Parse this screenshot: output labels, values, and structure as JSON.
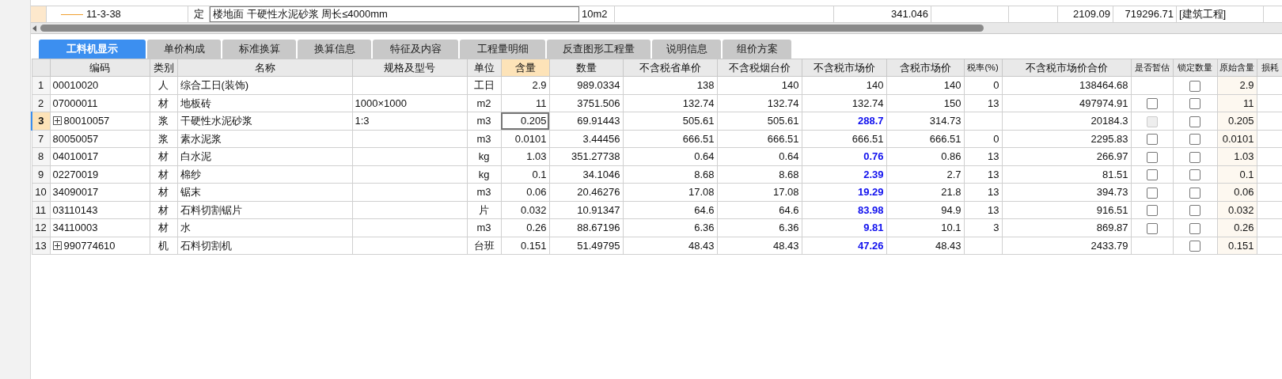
{
  "top_row": {
    "code": "11-3-38",
    "category": "定",
    "name": "楼地面 干硬性水泥砂浆 周长≤4000mm",
    "unit": "10m2",
    "column_6": "341.046",
    "column_9": "2109.09",
    "column_10": "719296.71",
    "column_11": "[建筑工程]"
  },
  "tabs": [
    {
      "label": "工料机显示",
      "selected": true
    },
    {
      "label": "单价构成",
      "selected": false
    },
    {
      "label": "标准换算",
      "selected": false
    },
    {
      "label": "换算信息",
      "selected": false
    },
    {
      "label": "特征及内容",
      "selected": false
    },
    {
      "label": "工程量明细",
      "selected": false
    },
    {
      "label": "反查图形工程量",
      "selected": false
    },
    {
      "label": "说明信息",
      "selected": false
    },
    {
      "label": "组价方案",
      "selected": false
    }
  ],
  "columns": [
    {
      "label": "编码",
      "selected": false
    },
    {
      "label": "类别",
      "selected": false
    },
    {
      "label": "名称",
      "selected": false
    },
    {
      "label": "规格及型号",
      "selected": false
    },
    {
      "label": "单位",
      "selected": false
    },
    {
      "label": "含量",
      "selected": true
    },
    {
      "label": "数量",
      "selected": false
    },
    {
      "label": "不含税省单价",
      "selected": false
    },
    {
      "label": "不含税烟台价",
      "selected": false
    },
    {
      "label": "不含税市场价",
      "selected": false
    },
    {
      "label": "含税市场价",
      "selected": false
    },
    {
      "label": "税率(%)",
      "selected": false
    },
    {
      "label": "不含税市场价合价",
      "selected": false
    },
    {
      "label": "是否暂估",
      "selected": false
    },
    {
      "label": "锁定数量",
      "selected": false
    },
    {
      "label": "原始含量",
      "selected": false
    },
    {
      "label": "损耗",
      "selected": false
    }
  ],
  "rows": [
    {
      "num": "1",
      "code": "00010020",
      "expandable": false,
      "category": "人",
      "name": "综合工日(装饰)",
      "spec": "",
      "unit": "工日",
      "content": "2.9",
      "quantity": "989.0334",
      "price_province": "138",
      "price_yantai": "140",
      "price_market": "140",
      "market_adjusted": false,
      "price_tax": "140",
      "tax_rate": "0",
      "total": "138464.68",
      "locked": false,
      "original_content": "2.9",
      "selected": false
    },
    {
      "num": "2",
      "code": "07000011",
      "expandable": false,
      "category": "材",
      "name": "地板砖",
      "spec": "1000×1000",
      "unit": "m2",
      "content": "11",
      "quantity": "3751.506",
      "price_province": "132.74",
      "price_yantai": "132.74",
      "price_market": "132.74",
      "market_adjusted": false,
      "price_tax": "150",
      "tax_rate": "13",
      "total": "497974.91",
      "provisional": {
        "checked": false,
        "disabled": false
      },
      "locked": false,
      "original_content": "11",
      "selected": false
    },
    {
      "num": "3",
      "code": "80010057",
      "expandable": true,
      "category": "浆",
      "name": "干硬性水泥砂浆",
      "spec": "1:3",
      "unit": "m3",
      "content": "0.205",
      "quantity": "69.91443",
      "price_province": "505.61",
      "price_yantai": "505.61",
      "price_market": "288.7",
      "market_adjusted": true,
      "price_tax": "314.73",
      "tax_rate": "",
      "total": "20184.3",
      "provisional": {
        "checked": false,
        "disabled": true
      },
      "locked": false,
      "original_content": "0.205",
      "selected": true
    },
    {
      "num": "7",
      "code": "80050057",
      "expandable": false,
      "category": "浆",
      "name": "素水泥浆",
      "spec": "",
      "unit": "m3",
      "content": "0.0101",
      "quantity": "3.44456",
      "price_province": "666.51",
      "price_yantai": "666.51",
      "price_market": "666.51",
      "market_adjusted": false,
      "price_tax": "666.51",
      "tax_rate": "0",
      "total": "2295.83",
      "provisional": {
        "checked": false,
        "disabled": false
      },
      "locked": false,
      "original_content": "0.0101",
      "selected": false
    },
    {
      "num": "8",
      "code": "04010017",
      "expandable": false,
      "category": "材",
      "name": "白水泥",
      "spec": "",
      "unit": "kg",
      "content": "1.03",
      "quantity": "351.27738",
      "price_province": "0.64",
      "price_yantai": "0.64",
      "price_market": "0.76",
      "market_adjusted": true,
      "price_tax": "0.86",
      "tax_rate": "13",
      "total": "266.97",
      "provisional": {
        "checked": false,
        "disabled": false
      },
      "locked": false,
      "original_content": "1.03",
      "selected": false
    },
    {
      "num": "9",
      "code": "02270019",
      "expandable": false,
      "category": "材",
      "name": "棉纱",
      "spec": "",
      "unit": "kg",
      "content": "0.1",
      "quantity": "34.1046",
      "price_province": "8.68",
      "price_yantai": "8.68",
      "price_market": "2.39",
      "market_adjusted": true,
      "price_tax": "2.7",
      "tax_rate": "13",
      "total": "81.51",
      "provisional": {
        "checked": false,
        "disabled": false
      },
      "locked": false,
      "original_content": "0.1",
      "selected": false
    },
    {
      "num": "10",
      "code": "34090017",
      "expandable": false,
      "category": "材",
      "name": "锯末",
      "spec": "",
      "unit": "m3",
      "content": "0.06",
      "quantity": "20.46276",
      "price_province": "17.08",
      "price_yantai": "17.08",
      "price_market": "19.29",
      "market_adjusted": true,
      "price_tax": "21.8",
      "tax_rate": "13",
      "total": "394.73",
      "provisional": {
        "checked": false,
        "disabled": false
      },
      "locked": false,
      "original_content": "0.06",
      "selected": false
    },
    {
      "num": "11",
      "code": "03110143",
      "expandable": false,
      "category": "材",
      "name": "石料切割锯片",
      "spec": "",
      "unit": "片",
      "content": "0.032",
      "quantity": "10.91347",
      "price_province": "64.6",
      "price_yantai": "64.6",
      "price_market": "83.98",
      "market_adjusted": true,
      "price_tax": "94.9",
      "tax_rate": "13",
      "total": "916.51",
      "provisional": {
        "checked": false,
        "disabled": false
      },
      "locked": false,
      "original_content": "0.032",
      "selected": false
    },
    {
      "num": "12",
      "code": "34110003",
      "expandable": false,
      "category": "材",
      "name": "水",
      "spec": "",
      "unit": "m3",
      "content": "0.26",
      "quantity": "88.67196",
      "price_province": "6.36",
      "price_yantai": "6.36",
      "price_market": "9.81",
      "market_adjusted": true,
      "price_tax": "10.1",
      "tax_rate": "3",
      "total": "869.87",
      "provisional": {
        "checked": false,
        "disabled": false
      },
      "locked": false,
      "original_content": "0.26",
      "selected": false
    },
    {
      "num": "13",
      "code": "990774610",
      "expandable": true,
      "category": "机",
      "name": "石料切割机",
      "spec": "",
      "unit": "台班",
      "content": "0.151",
      "quantity": "51.49795",
      "price_province": "48.43",
      "price_yantai": "48.43",
      "price_market": "47.26",
      "market_adjusted": true,
      "price_tax": "48.43",
      "tax_rate": "",
      "total": "2433.79",
      "locked": false,
      "original_content": "0.151",
      "selected": false
    }
  ]
}
